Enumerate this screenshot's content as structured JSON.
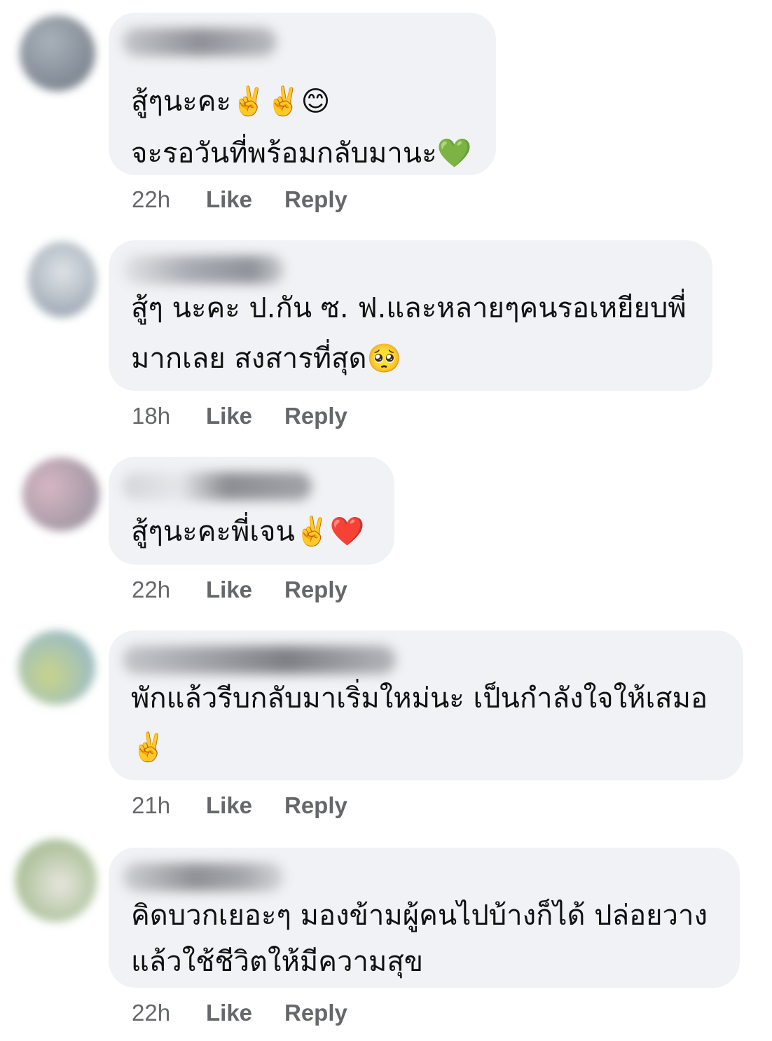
{
  "comments": [
    {
      "lines": [
        "สู้ๆนะคะ✌️✌️😊",
        "จะรอวันที่พร้อมกลับมานะ💚"
      ],
      "time": "22h",
      "like": "Like",
      "reply": "Reply",
      "avatar_colors": [
        "#7f8690",
        "#a9b1bb"
      ]
    },
    {
      "lines": [
        "สู้ๆ นะคะ ป.กัน ซ. ฟ.และหลายๆคนรอเหยียบพี่",
        "มากเลย สงสารที่สุด🥺"
      ],
      "time": "18h",
      "like": "Like",
      "reply": "Reply",
      "avatar_colors": [
        "#c9ced6",
        "#8e9ba8"
      ]
    },
    {
      "lines": [
        "สู้ๆนะคะพี่เจน✌️❤️"
      ],
      "time": "22h",
      "like": "Like",
      "reply": "Reply",
      "avatar_colors": [
        "#c9a7b3",
        "#8f8d98"
      ]
    },
    {
      "lines": [
        "พักแล้วรีบกลับมาเริ่มใหม่นะ เป็นกำลังใจให้เสมอ",
        "✌️"
      ],
      "time": "21h",
      "like": "Like",
      "reply": "Reply",
      "avatar_colors": [
        "#c8d48a",
        "#8ab3d8"
      ]
    },
    {
      "lines": [
        "คิดบวกเยอะๆ มองข้ามผู้คนไปบ้างก็ได้ ปล่อยวาง",
        "แล้วใช้ชีวิตให้มีความสุข"
      ],
      "time": "22h",
      "like": "Like",
      "reply": "Reply",
      "avatar_colors": [
        "#9fb489",
        "#e7e6de"
      ]
    }
  ]
}
